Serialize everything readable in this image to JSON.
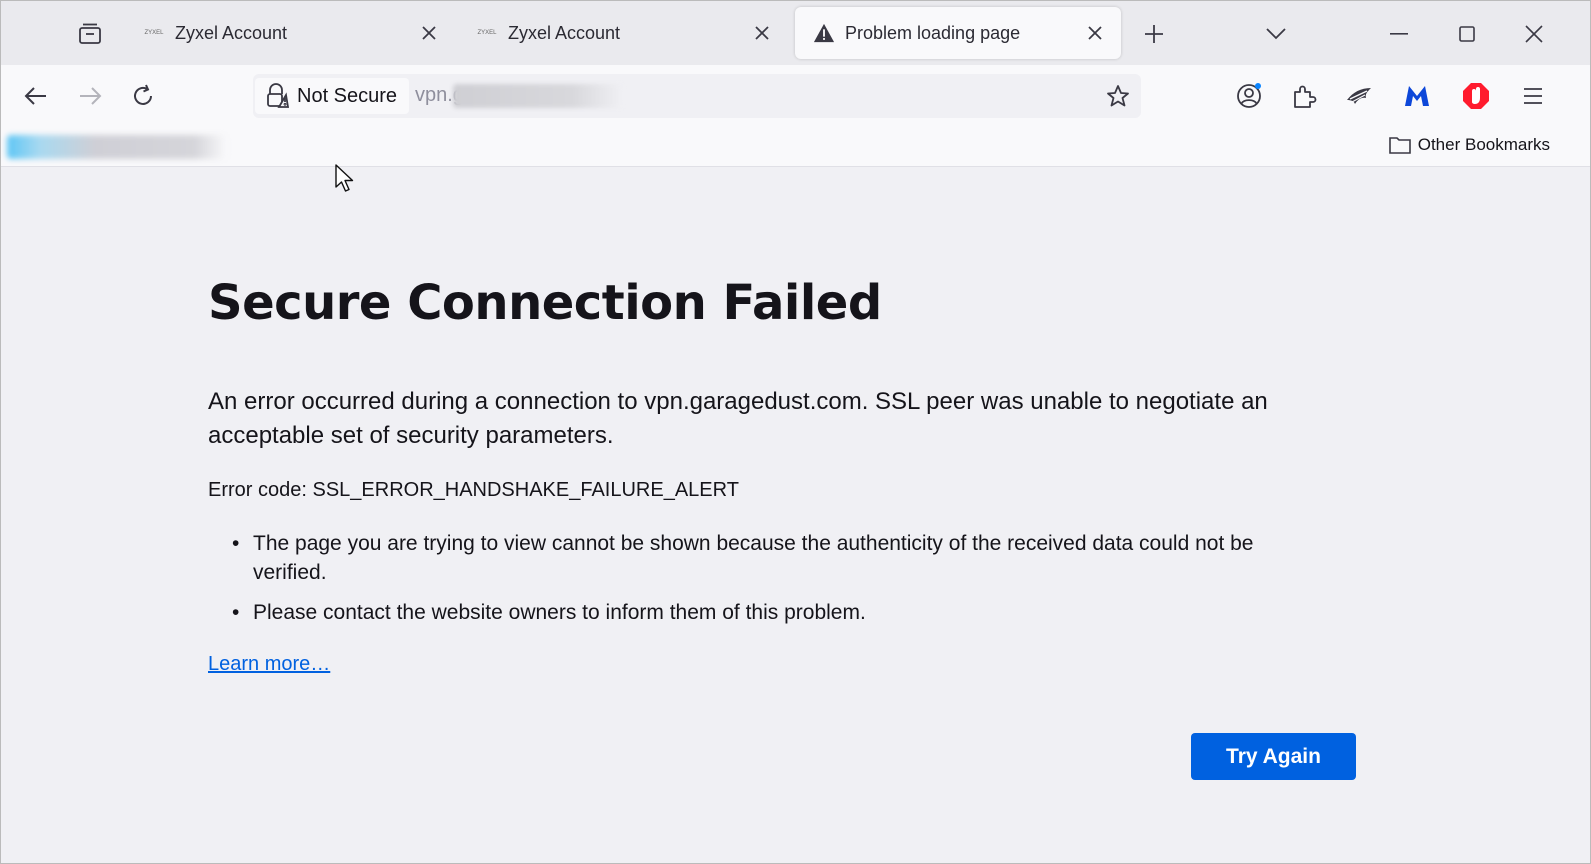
{
  "tabs": [
    {
      "title": "Zyxel Account",
      "favicon": "ZYXEL",
      "active": false
    },
    {
      "title": "Zyxel Account",
      "favicon": "ZYXEL",
      "active": false
    },
    {
      "title": "Problem loading page",
      "favicon": "warning-icon",
      "active": true
    }
  ],
  "urlbar": {
    "security_label": "Not Secure",
    "url_visible": "vpn.g"
  },
  "bookmarks": {
    "other_label": "Other Bookmarks"
  },
  "error": {
    "title": "Secure Connection Failed",
    "description": "An error occurred during a connection to vpn.garagedust.com. SSL peer was unable to negotiate an acceptable set of security parameters.",
    "code_line": "Error code: SSL_ERROR_HANDSHAKE_FAILURE_ALERT",
    "bullets": [
      "The page you are trying to view cannot be shown because the authenticity of the received data could not be verified.",
      "Please contact the website owners to inform them of this problem."
    ],
    "learn_more": "Learn more…",
    "try_again": "Try Again"
  },
  "colors": {
    "accent": "#0061e0",
    "page_bg": "#f0f0f4",
    "malwarebytes": "#0d47d9",
    "opera_red": "#ff1b2d"
  }
}
